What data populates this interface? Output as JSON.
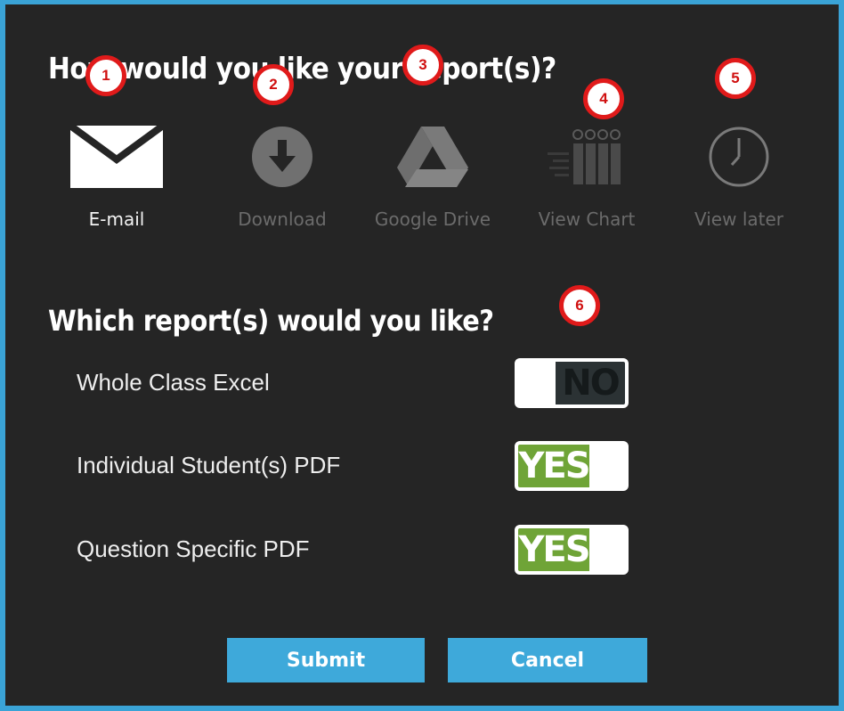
{
  "dialog": {
    "delivery_heading": "How would you like your report(s)?",
    "reports_heading": "Which report(s) would you like?",
    "delivery_options": [
      {
        "label": "E-mail",
        "icon": "envelope-icon",
        "active": true
      },
      {
        "label": "Download",
        "icon": "download-icon",
        "active": false
      },
      {
        "label": "Google Drive",
        "icon": "google-drive-icon",
        "active": false
      },
      {
        "label": "View Chart",
        "icon": "chart-icon",
        "active": false
      },
      {
        "label": "View later",
        "icon": "clock-icon",
        "active": false
      }
    ],
    "reports": [
      {
        "label": "Whole Class Excel",
        "value": "NO"
      },
      {
        "label": "Individual Student(s) PDF",
        "value": "YES"
      },
      {
        "label": "Question Specific PDF",
        "value": "YES"
      }
    ],
    "submit_label": "Submit",
    "cancel_label": "Cancel"
  },
  "markers": [
    "1",
    "2",
    "3",
    "4",
    "5",
    "6"
  ],
  "colors": {
    "background": "#252525",
    "border": "#3aa3d6",
    "button": "#3ea9da",
    "toggle_yes": "#6fa437",
    "toggle_no": "#2b3234",
    "marker": "#e01a1a",
    "inactive_text": "#6b6b6b"
  }
}
